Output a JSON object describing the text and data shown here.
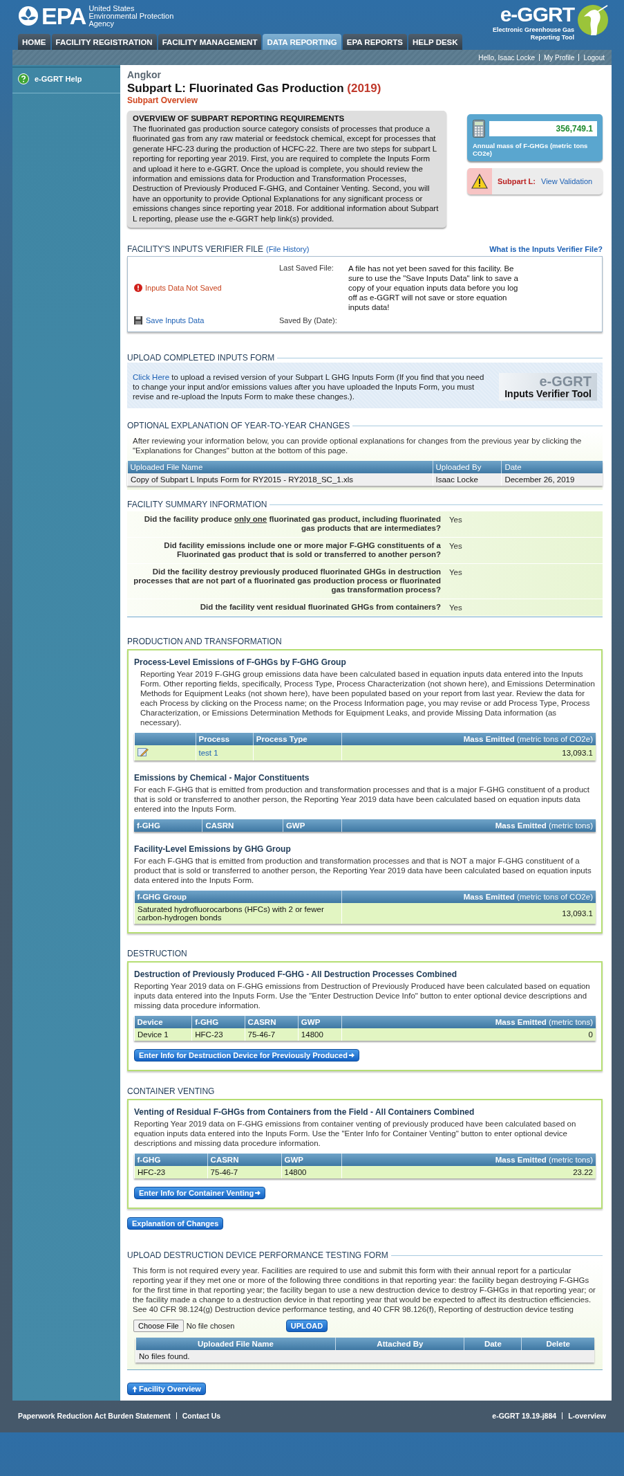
{
  "header": {
    "agency_mark": "EPA",
    "agency_lines": [
      "United States",
      "Environmental Protection",
      "Agency"
    ],
    "app_logo": "e-GGRT",
    "app_name_lines": [
      "Electronic Greenhouse Gas",
      "Reporting Tool"
    ]
  },
  "nav_tabs": [
    {
      "label": "HOME",
      "selected": false
    },
    {
      "label": "FACILITY REGISTRATION",
      "selected": false
    },
    {
      "label": "FACILITY MANAGEMENT",
      "selected": false
    },
    {
      "label": "DATA REPORTING",
      "selected": true
    },
    {
      "label": "EPA REPORTS",
      "selected": false
    },
    {
      "label": "HELP DESK",
      "selected": false
    }
  ],
  "user_bar": {
    "greeting": "Hello, Isaac Locke",
    "links": [
      "My Profile",
      "Logout"
    ]
  },
  "sidebar": {
    "items": [
      {
        "label": "e-GGRT Help"
      }
    ]
  },
  "facility": "Angkor",
  "title": "Subpart L: Fluorinated Gas Production",
  "year": "(2019)",
  "breadcrumb": "Subpart Overview",
  "overview": {
    "heading": "OVERVIEW OF SUBPART REPORTING REQUIREMENTS",
    "text": "The fluorinated gas production source category consists of processes that produce a fluorinated gas from any raw material or feedstock chemical, except for processes that generate HFC-23 during the production of HCFC-22. There are two steps for subpart L reporting for reporting year 2019. First, you are required to complete the Inputs Form and upload it here to e-GGRT. Once the upload is complete, you should review the information and emissions data for Production and Transformation Processes, Destruction of Previously Produced F-GHG, and Container Venting. Second, you will have an opportunity to provide Optional Explanations for any significant process or emissions changes since reporting year 2018. For additional information about Subpart L reporting, please use the e-GGRT help link(s) provided."
  },
  "stat": {
    "value": "356,749.1",
    "label": "Annual mass of F-GHGs (metric tons CO2e)"
  },
  "validation": {
    "label": "Subpart L:",
    "link": "View Validation"
  },
  "verifier": {
    "heading": "FACILITY'S INPUTS VERIFIER FILE",
    "history_link": "(File History)",
    "help_link": "What is the Inputs Verifier File?",
    "status": "Inputs Data Not Saved",
    "save_link": "Save Inputs Data",
    "last_saved_label": "Last Saved File:",
    "last_saved_text": "A file has not yet been saved for this facility. Be sure to use the \"Save Inputs Data\" link to save a copy of your equation inputs data before you log off as e-GGRT will not save or store equation inputs data!",
    "saved_by_label": "Saved By (Date):"
  },
  "upload": {
    "heading": "UPLOAD COMPLETED INPUTS FORM",
    "link": "Click Here",
    "text": " to upload a revised version of your Subpart L GHG Inputs Form (If you find that you need to change your input and/or emissions values after you have uploaded the Inputs Form, you must revise and re-upload the Inputs Form to make these changes.).",
    "tool_logo": "e-GGRT",
    "tool_name": "Inputs Verifier Tool"
  },
  "explanation": {
    "heading": "OPTIONAL EXPLANATION OF YEAR-TO-YEAR CHANGES",
    "text": "After reviewing your information below, you can provide optional explanations for changes from the previous year by clicking the \"Explanations for Changes\" button at the bottom of this page.",
    "table": {
      "kind": "files",
      "columns": [
        "Uploaded File Name",
        "Uploaded By",
        "Date"
      ],
      "rows": [
        [
          "Copy of Subpart L Inputs Form for RY2015 - RY2018_SC_1.xls",
          "Isaac Locke",
          "December 26, 2019"
        ]
      ]
    }
  },
  "summary": {
    "heading": "FACILITY SUMMARY INFORMATION",
    "rows": [
      {
        "question": [
          {
            "text": "Did the facility produce ",
            "underlined": false
          },
          {
            "text": "only one",
            "underlined": true
          },
          {
            "text": " fluorinated gas product, including fluorinated gas products that are intermediates?",
            "underlined": false
          }
        ],
        "answer": "Yes"
      },
      {
        "question": [
          {
            "text": "Did facility emissions include one or more major F-GHG constituents of a Fluorinated gas product that is sold or transferred to another person?",
            "underlined": false
          }
        ],
        "answer": "Yes"
      },
      {
        "question": [
          {
            "text": "Did the facility destroy previously produced fluorinated GHGs in destruction processes that are not part of a fluorinated gas production process or fluorinated gas transformation process?",
            "underlined": false
          }
        ],
        "answer": "Yes"
      },
      {
        "question": [
          {
            "text": "Did the facility vent residual fluorinated GHGs from containers?",
            "underlined": false
          }
        ],
        "answer": "Yes"
      }
    ]
  },
  "sections": [
    {
      "heading": "PRODUCTION AND TRANSFORMATION",
      "blocks": [
        {
          "title": "Process-Level Emissions of F-GHGs by F-GHG Group",
          "indented": true,
          "text": "Reporting Year 2019 F-GHG group emissions data have been calculated based in equation inputs data entered into the Inputs Form. Other reporting fields, specifically, Process Type, Process Characterization (not shown here), and Emissions Determination Methods for Equipment Leaks (not shown here), have been populated based on your report from last year. Review the data for each Process by clicking on the Process name; on the Process Information page, you may revise or add Process Type, Process Characterization, or Emissions Determination Methods for Equipment Leaks, and provide Missing Data information (as necessary).",
          "table": {
            "kind": "process",
            "columns": [
              "**Process**",
              "**Process Type**",
              "**Mass Emitted** (metric tons of CO2e)"
            ],
            "rows": [
              [
                "test 1",
                "",
                "13,093.1"
              ]
            ]
          }
        },
        {
          "title": "Emissions by Chemical - Major Constituents",
          "indented": false,
          "text": "For each F-GHG that is emitted from production and transformation processes and that is a major F-GHG constituent of a product that is sold or transferred to another person, the Reporting Year 2019 data have been calculated based on equation inputs data entered into the Inputs Form.",
          "table": {
            "kind": "data",
            "columns": [
              "**f-GHG**",
              "**CASRN**",
              "**GWP**",
              "**Mass Emitted** (metric tons)"
            ]
          }
        },
        {
          "title": "Facility-Level Emissions by GHG Group",
          "indented": false,
          "text": "For each F-GHG that is emitted from production and transformation processes and that is NOT a major F-GHG constituent of a product that is sold or transferred to another person, the Reporting Year 2019 data have been calculated based on equation inputs data entered into the Inputs Form.",
          "table": {
            "kind": "data",
            "columns": [
              "**f-GHG Group**",
              "**Mass Emitted** (metric tons of CO2e)"
            ],
            "rows": [
              [
                "Saturated hydrofluorocarbons (HFCs) with 2 or fewer carbon-hydrogen bonds",
                "13,093.1"
              ]
            ]
          }
        }
      ]
    },
    {
      "heading": "DESTRUCTION",
      "blocks": [
        {
          "title": "Destruction of Previously Produced F-GHG - All Destruction Processes Combined",
          "indented": false,
          "text": "Reporting Year 2019 data on F-GHG emissions from Destruction of Previously Produced have been calculated based on equation inputs data entered into the Inputs Form. Use the \"Enter Destruction Device Info\" button to enter optional device descriptions and missing data procedure information.",
          "table": {
            "kind": "data",
            "columns": [
              "**Device**",
              "**f-GHG**",
              "**CASRN**",
              "**GWP**",
              "**Mass Emitted** (metric tons)"
            ],
            "rows": [
              [
                "Device 1",
                "HFC-23",
                "75-46-7",
                "14800",
                "0"
              ]
            ]
          },
          "button": "Enter Info for Destruction Device for Previously Produced"
        }
      ]
    },
    {
      "heading": "CONTAINER VENTING",
      "blocks": [
        {
          "title": "Venting of Residual F-GHGs from Containers from the Field - All Containers Combined",
          "indented": false,
          "text": "Reporting Year 2019 data on F-GHG emissions from container venting of previously produced have been calculated based on equation inputs data entered into the Inputs Form. Use the \"Enter Info for Container Venting\" button to enter optional device descriptions and missing data procedure information.",
          "table": {
            "kind": "data",
            "columns": [
              "**f-GHG**",
              "**CASRN**",
              "**GWP**",
              "**Mass Emitted** (metric tons)"
            ],
            "rows": [
              [
                "HFC-23",
                "75-46-7",
                "14800",
                "23.22"
              ]
            ]
          },
          "button": "Enter Info for Container Venting"
        }
      ]
    }
  ],
  "changes_button": "Explanation of Changes",
  "testing_form": {
    "heading": "UPLOAD DESTRUCTION DEVICE PERFORMANCE TESTING FORM",
    "text": "This form is not required every year. Facilities are required to use and submit this form with their annual report for a particular reporting year if they met one or more of the following three conditions in that reporting year: the facility began destroying F-GHGs for the first time in that reporting year; the facility began to use a new destruction device to destroy F-GHGs in that reporting year; or the facility made a change to a destruction device in that reporting year that would be expected to affect its destruction efficiencies. See 40 CFR 98.124(g) Destruction device performance testing, and 40 CFR 98.126(f), Reporting of destruction device testing",
    "choose_button": "Choose File",
    "file_status": "No file chosen",
    "upload_button": "UPLOAD",
    "table": {
      "columns": [
        "Uploaded File Name",
        "Attached By",
        "Date",
        "Delete"
      ],
      "empty": "No files found."
    }
  },
  "overview_button": "Facility Overview",
  "footer": {
    "left": [
      "Paperwork Reduction Act Burden Statement",
      "Contact Us"
    ],
    "right": [
      "e-GGRT 19.19-j884",
      "L-overview"
    ]
  }
}
